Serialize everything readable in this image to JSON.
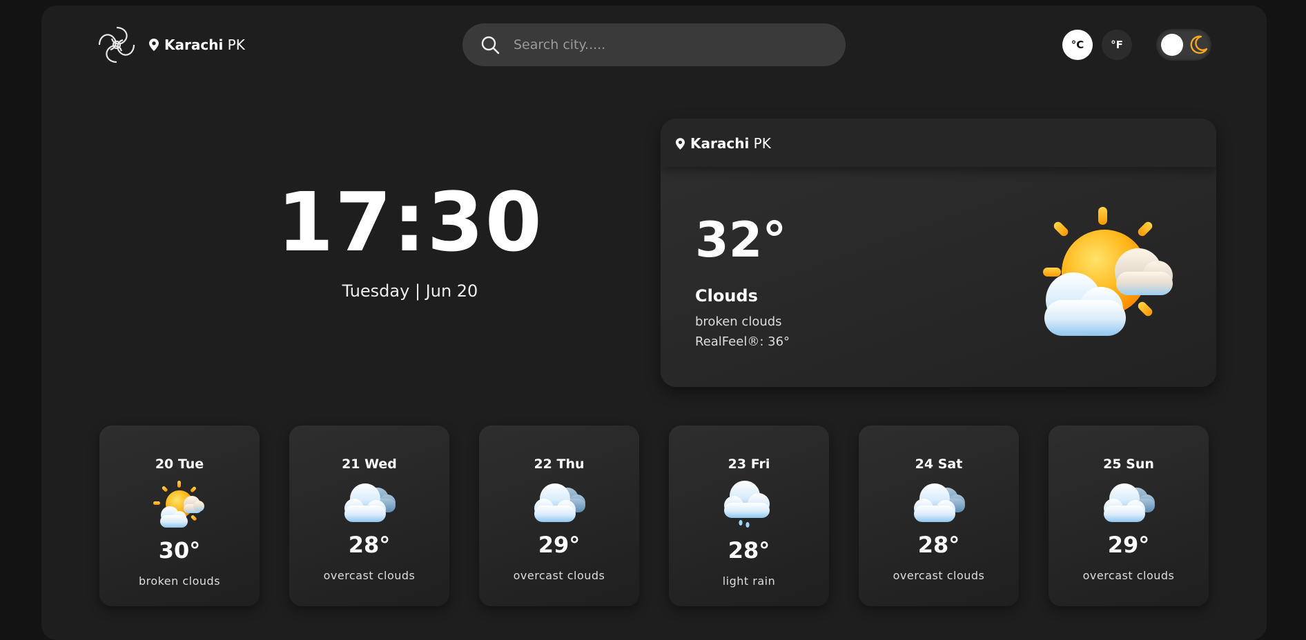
{
  "header": {
    "location_city": "Karachi",
    "location_country": "PK",
    "search_placeholder": "Search city.....",
    "unit_celsius": "°C",
    "unit_fahrenheit": "°F",
    "theme_mode": "dark"
  },
  "clock": {
    "time": "17:30",
    "date": "Tuesday | Jun 20"
  },
  "current": {
    "location_city": "Karachi",
    "location_country": "PK",
    "temperature": "32°",
    "condition": "Clouds",
    "description": "broken clouds",
    "realfeel_label": "RealFeel®:",
    "realfeel_value": "36°",
    "icon": "sun-behind-clouds-icon"
  },
  "forecast": [
    {
      "day": "20 Tue",
      "temp": "30°",
      "desc": "broken clouds",
      "icon": "sun-behind-clouds-icon"
    },
    {
      "day": "21 Wed",
      "temp": "28°",
      "desc": "overcast clouds",
      "icon": "clouds-icon"
    },
    {
      "day": "22 Thu",
      "temp": "29°",
      "desc": "overcast clouds",
      "icon": "clouds-icon"
    },
    {
      "day": "23 Fri",
      "temp": "28°",
      "desc": "light rain",
      "icon": "rain-cloud-icon"
    },
    {
      "day": "24 Sat",
      "temp": "28°",
      "desc": "overcast clouds",
      "icon": "clouds-icon"
    },
    {
      "day": "25 Sun",
      "temp": "29°",
      "desc": "overcast clouds",
      "icon": "clouds-icon"
    }
  ],
  "colors": {
    "background": "#131313",
    "panel": "#1e1e1e",
    "accent_moon": "#f5a623",
    "sun": "#ffb300"
  }
}
